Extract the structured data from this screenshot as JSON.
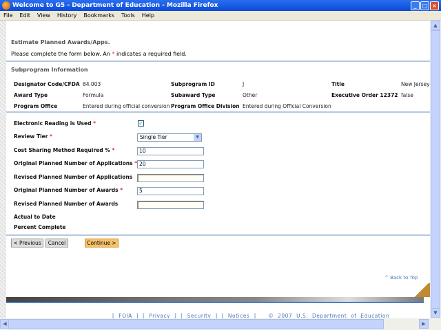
{
  "window": {
    "title": "Welcome to G5 - Department of Education - Mozilla Firefox"
  },
  "menu": [
    "File",
    "Edit",
    "View",
    "History",
    "Bookmarks",
    "Tools",
    "Help"
  ],
  "page": {
    "heading": "Estimate Planned Awards/Apps.",
    "instructions_pre": "Please complete the form below. An",
    "required_mark": "*",
    "instructions_post": "indicates a required field.",
    "section": "Subprogram Information"
  },
  "info": {
    "designator_label": "Designator Code/CFDA",
    "designator_value": "84.003",
    "subprogram_id_label": "Subprogram ID",
    "subprogram_id_value": "J",
    "title_label": "Title",
    "title_value": "New Jersey S",
    "award_type_label": "Award Type",
    "award_type_value": "Formula",
    "subaward_type_label": "Subaward Type",
    "subaward_type_value": "Other",
    "exec_order_label": "Executive Order 12372",
    "exec_order_value": "false",
    "program_office_label": "Program Office",
    "program_office_value": "Entered during official conversion",
    "division_label": "Program Office Division",
    "division_value": "Entered during Official Conversion"
  },
  "form": {
    "electronic_label": "Electronic Reading is Used",
    "electronic_checked": true,
    "review_tier_label": "Review Tier",
    "review_tier_value": "Single Tier",
    "cost_sharing_label": "Cost Sharing Method Required %",
    "cost_sharing_value": "10",
    "orig_apps_label": "Original Planned Number of Applications",
    "orig_apps_value": "20",
    "rev_apps_label": "Revised Planned Number of Applications",
    "rev_apps_value": "",
    "orig_awards_label": "Original Planned Number of Awards",
    "orig_awards_value": "5",
    "rev_awards_label": "Revised Planned Number of Awards",
    "rev_awards_value": "",
    "actual_label": "Actual to Date",
    "percent_label": "Percent Complete"
  },
  "buttons": {
    "previous": "< Previous",
    "cancel": "Cancel",
    "continue": "Continue >"
  },
  "back_to_top": "^ Back to Top",
  "footer": {
    "foia": "FOIA",
    "privacy": "Privacy",
    "security": "Security",
    "notices": "Notices",
    "copyright": "© 2007 U.S. Department of Education"
  },
  "colors": {
    "accent": "#4a78b8",
    "continue_button": "#f7c16a",
    "required": "#e03030"
  }
}
